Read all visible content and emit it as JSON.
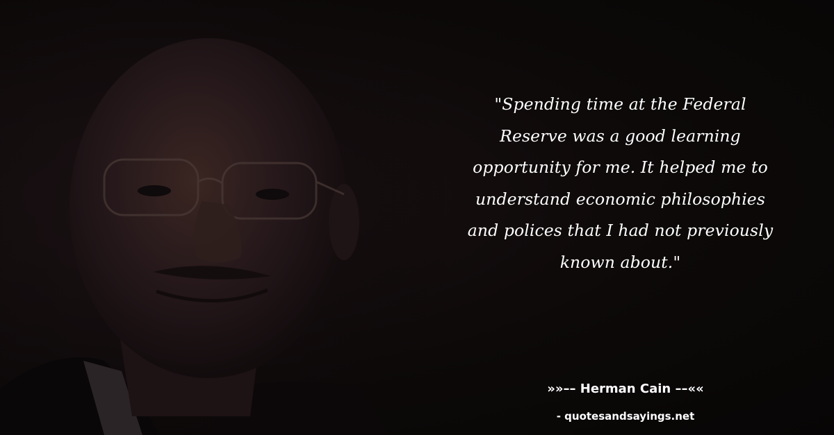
{
  "quote": {
    "text": "\"Spending time at the Federal Reserve was a good learning opportunity for me. It helped me to understand economic philosophies and polices that I had not previously known about.\""
  },
  "author": {
    "line": "»»–– Herman Cain ––««"
  },
  "source": {
    "line": "- quotesandsayings.net"
  },
  "colors": {
    "background": "#0c0809",
    "text": "#ffffff"
  }
}
